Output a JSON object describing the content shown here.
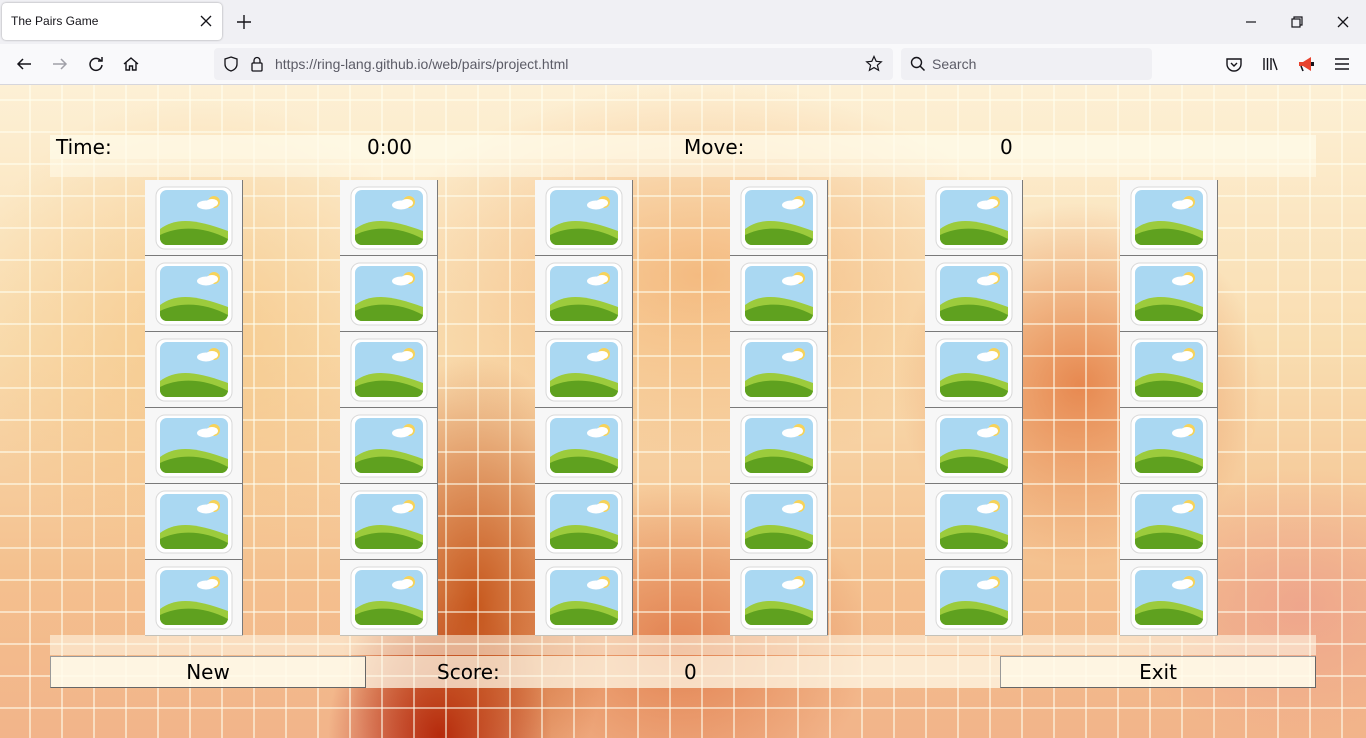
{
  "browser": {
    "tab_title": "The Pairs Game",
    "url": "https://ring-lang.github.io/web/pairs/project.html",
    "search_placeholder": "Search"
  },
  "game": {
    "time_label": "Time:",
    "time_value": "0:00",
    "move_label": "Move:",
    "move_value": "0",
    "score_label": "Score:",
    "score_value": "0",
    "new_label": "New",
    "exit_label": "Exit",
    "grid_columns": 6,
    "grid_rows": 6,
    "card_face": "landscape-icon"
  }
}
